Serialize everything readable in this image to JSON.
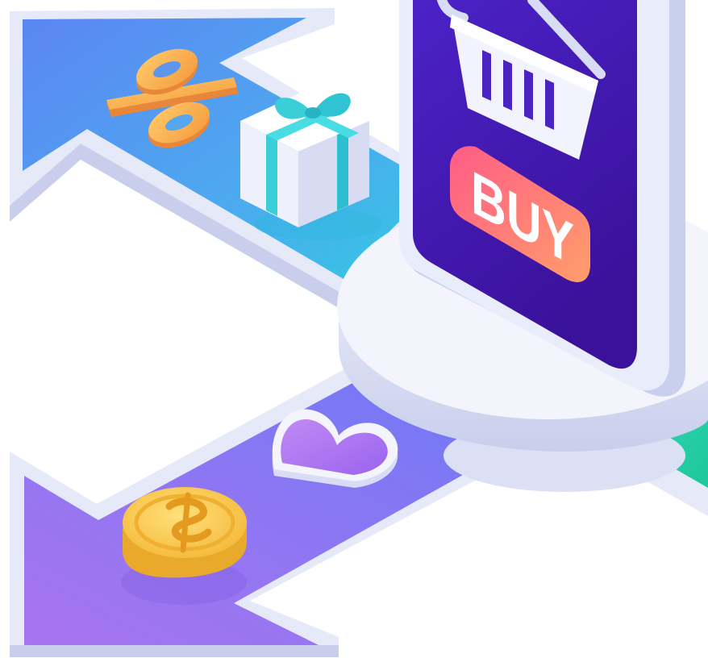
{
  "illustration": {
    "buy_button_label": "BUY",
    "colors": {
      "arrow_top_start": "#5B86F2",
      "arrow_top_end": "#35C7E3",
      "arrow_bottom_start": "#A874F0",
      "arrow_bottom_end": "#6A79F5",
      "arrow_right": "#2ED3A5",
      "phone_screen_top": "#4B22C7",
      "phone_screen_bottom": "#3A119A",
      "buy_button_start": "#FF6287",
      "buy_button_end": "#FF9A6B",
      "coin": "#F6C64A",
      "heart": "#A56CF0",
      "gift_ribbon": "#34D0D7",
      "percent_sign": "#F7B04F",
      "platform": "#F1F2FB"
    },
    "icons": [
      "percent-sign-icon",
      "gift-box-icon",
      "shopping-basket-icon",
      "heart-icon",
      "dollar-coin-icon"
    ]
  }
}
